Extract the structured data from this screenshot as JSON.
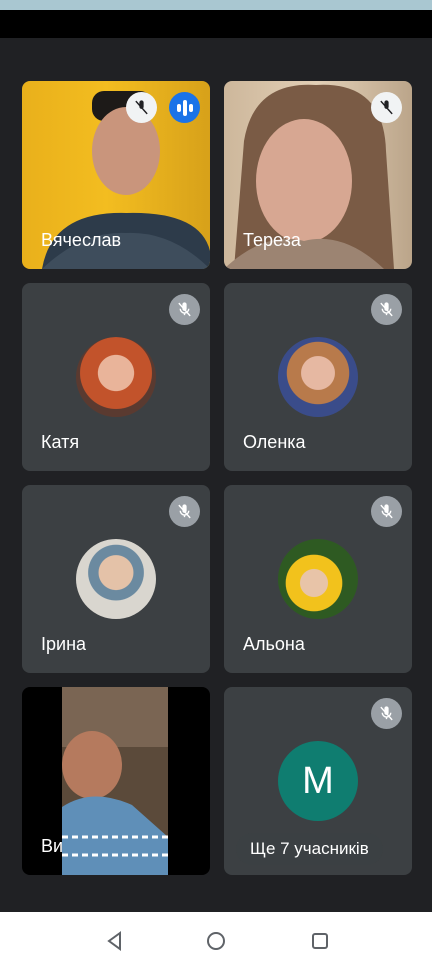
{
  "participants": [
    {
      "name": "Вячеслав",
      "type": "video",
      "speaking": true
    },
    {
      "name": "Тереза",
      "type": "video"
    },
    {
      "name": "Катя",
      "type": "avatar"
    },
    {
      "name": "Оленка",
      "type": "avatar"
    },
    {
      "name": "Ірина",
      "type": "avatar"
    },
    {
      "name": "Альона",
      "type": "avatar"
    },
    {
      "name": "Ви",
      "type": "video"
    }
  ],
  "others_tile": {
    "initial": "M",
    "initial_color": "#0f7d70",
    "more_label": "Ще 7 учасників"
  },
  "icons": {
    "mute": "mic-off-icon",
    "speaking": "audio-level-icon",
    "nav_back": "back-triangle-icon",
    "nav_home": "home-circle-icon",
    "nav_recents": "recents-square-icon"
  },
  "colors": {
    "background": "#202124",
    "tile": "#3c4043",
    "speaking": "#1a73e8"
  }
}
